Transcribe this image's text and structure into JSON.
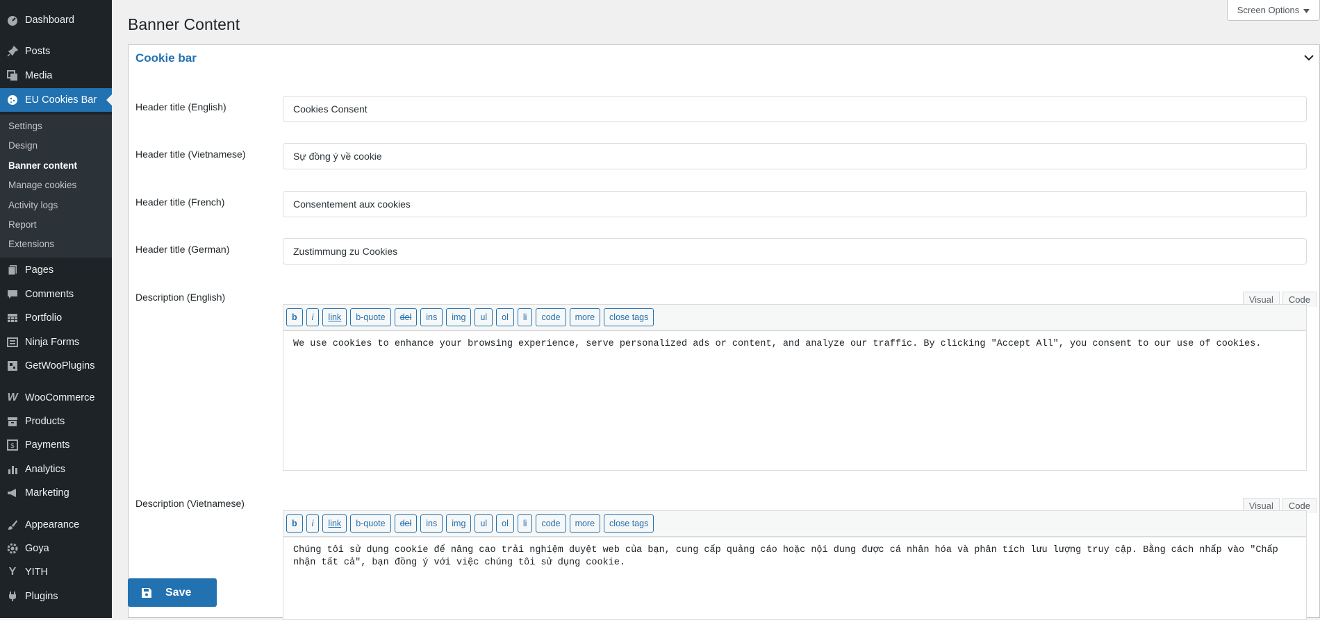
{
  "sidebar": {
    "items": [
      {
        "label": "Dashboard",
        "icon": "dashboard-icon"
      },
      {
        "label": "Posts",
        "icon": "pin-icon"
      },
      {
        "label": "Media",
        "icon": "media-icon"
      },
      {
        "label": "EU Cookies Bar",
        "icon": "cookie-icon"
      },
      {
        "label": "Pages",
        "icon": "pages-icon"
      },
      {
        "label": "Comments",
        "icon": "comment-icon"
      },
      {
        "label": "Portfolio",
        "icon": "portfolio-icon"
      },
      {
        "label": "Ninja Forms",
        "icon": "forms-icon"
      },
      {
        "label": "GetWooPlugins",
        "icon": "plugin-icon"
      },
      {
        "label": "WooCommerce",
        "icon": "woo-icon"
      },
      {
        "label": "Products",
        "icon": "archive-icon"
      },
      {
        "label": "Payments",
        "icon": "payments-icon"
      },
      {
        "label": "Analytics",
        "icon": "chart-icon"
      },
      {
        "label": "Marketing",
        "icon": "megaphone-icon"
      },
      {
        "label": "Appearance",
        "icon": "brush-icon"
      },
      {
        "label": "Goya",
        "icon": "gear-icon"
      },
      {
        "label": "YITH",
        "icon": "yith-icon"
      },
      {
        "label": "Plugins",
        "icon": "plug-icon"
      }
    ],
    "submenu": [
      "Settings",
      "Design",
      "Banner content",
      "Manage cookies",
      "Activity logs",
      "Report",
      "Extensions"
    ]
  },
  "page": {
    "title": "Banner Content",
    "screen_options": "Screen Options"
  },
  "panel": {
    "title": "Cookie bar",
    "fields": [
      {
        "label": "Header title (English)",
        "value": "Cookies Consent"
      },
      {
        "label": "Header title (Vietnamese)",
        "value": "Sự đồng ý về cookie"
      },
      {
        "label": "Header title (French)",
        "value": "Consentement aux cookies"
      },
      {
        "label": "Header title (German)",
        "value": "Zustimmung zu Cookies"
      }
    ],
    "editor_tabs": {
      "visual": "Visual",
      "code": "Code"
    },
    "quicktags": [
      "b",
      "i",
      "link",
      "b-quote",
      "del",
      "ins",
      "img",
      "ul",
      "ol",
      "li",
      "code",
      "more",
      "close tags"
    ],
    "descriptions": [
      {
        "label": "Description (English)",
        "value": "We use cookies to enhance your browsing experience, serve personalized ads or content, and analyze our traffic. By clicking \"Accept All\", you consent to our use of cookies."
      },
      {
        "label": "Description (Vietnamese)",
        "value": "Chúng tôi sử dụng cookie để nâng cao trải nghiệm duyệt web của bạn, cung cấp quảng cáo hoặc nội dung được cá nhân hóa và phân tích lưu lượng truy cập. Bằng cách nhấp vào \"Chấp nhận tất cả\", bạn đồng ý với việc chúng tôi sử dụng cookie."
      }
    ]
  },
  "save_label": "Save"
}
